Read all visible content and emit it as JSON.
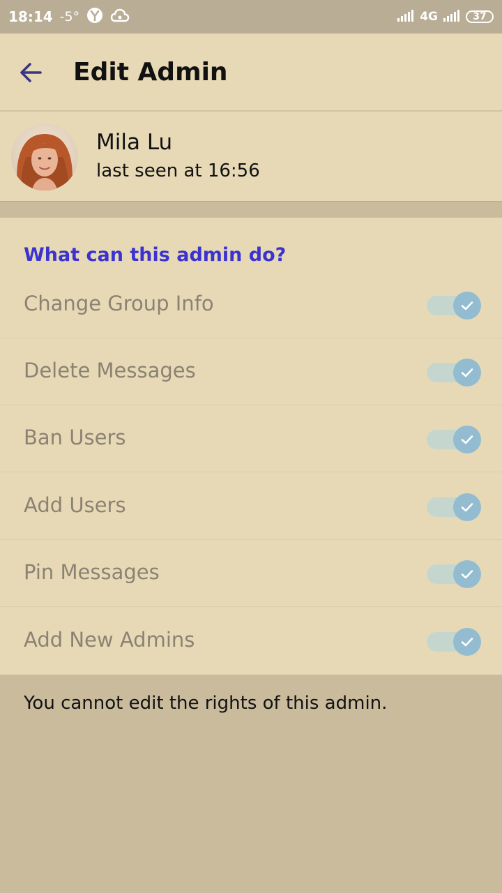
{
  "status_bar": {
    "time": "18:14",
    "temperature": "-5°",
    "network": "4G",
    "battery": "37"
  },
  "toolbar": {
    "title": "Edit Admin"
  },
  "profile": {
    "name": "Mila Lu",
    "status": "last seen at 16:56"
  },
  "permissions": {
    "header": "What can this admin do?",
    "items": [
      {
        "label": "Change Group Info",
        "enabled": true
      },
      {
        "label": "Delete Messages",
        "enabled": true
      },
      {
        "label": "Ban Users",
        "enabled": true
      },
      {
        "label": "Add Users",
        "enabled": true
      },
      {
        "label": "Pin Messages",
        "enabled": true
      },
      {
        "label": "Add New Admins",
        "enabled": true
      }
    ]
  },
  "footer": {
    "note": "You cannot edit the rights of this admin."
  },
  "colors": {
    "background": "#c9bb9c",
    "surface": "#e8d9b6",
    "accent": "#3a33d0",
    "toggle_knob": "#93bcd0"
  }
}
